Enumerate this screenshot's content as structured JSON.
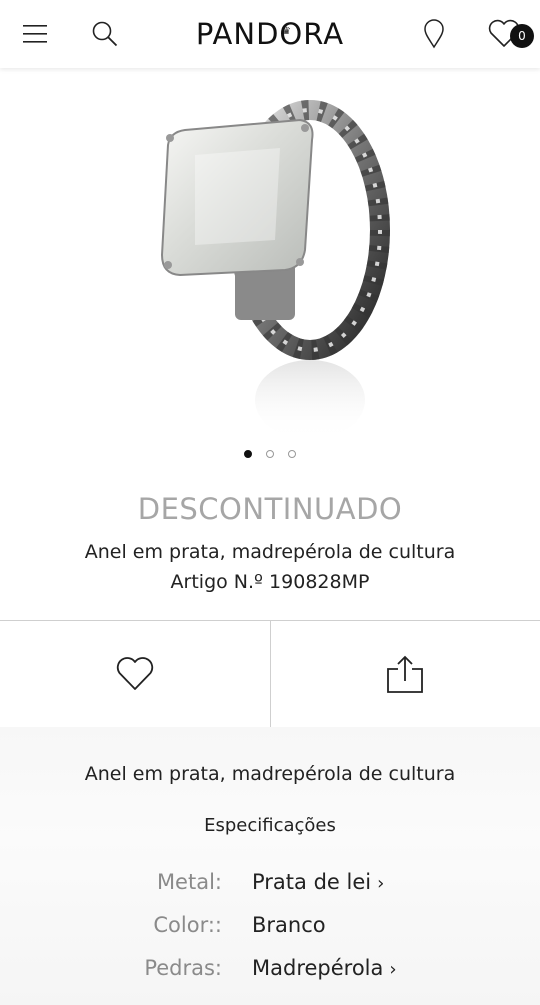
{
  "header": {
    "brand": "PANDORA",
    "wishlist_count": "0"
  },
  "product": {
    "status": "DESCONTINUADO",
    "title": "Anel em prata, madrepérola de cultura",
    "article": "Artigo N.º 190828MP",
    "image_dots": {
      "count": 3,
      "active_index": 0
    }
  },
  "details": {
    "description": "Anel em prata, madrepérola de cultura",
    "specs_heading": "Especificações",
    "specs": [
      {
        "label": "Metal:",
        "value": "Prata de lei",
        "link": true
      },
      {
        "label": "Color::",
        "value": "Branco",
        "link": false
      },
      {
        "label": "Pedras:",
        "value": "Madrepérola",
        "link": true
      }
    ]
  },
  "icons": {
    "menu": "menu-icon",
    "search": "search-icon",
    "store": "location-pin-icon",
    "wishlist": "heart-icon",
    "share": "share-icon"
  }
}
